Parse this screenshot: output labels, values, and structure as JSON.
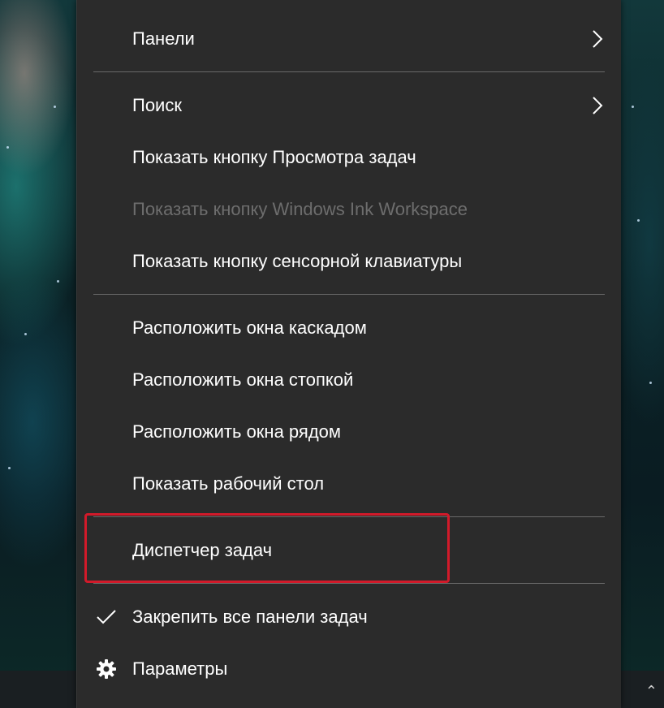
{
  "menu": {
    "items": [
      {
        "label": "Панели",
        "submenu": true,
        "enabled": true
      },
      {
        "label": "Поиск",
        "submenu": true,
        "enabled": true
      },
      {
        "label": "Показать кнопку Просмотра задач",
        "enabled": true
      },
      {
        "label": "Показать кнопку Windows Ink Workspace",
        "enabled": false
      },
      {
        "label": "Показать кнопку сенсорной клавиатуры",
        "enabled": true
      },
      {
        "label": "Расположить окна каскадом",
        "enabled": true
      },
      {
        "label": "Расположить окна стопкой",
        "enabled": true
      },
      {
        "label": "Расположить окна рядом",
        "enabled": true
      },
      {
        "label": "Показать рабочий стол",
        "enabled": true
      },
      {
        "label": "Диспетчер задач",
        "enabled": true,
        "highlighted": true
      },
      {
        "label": "Закрепить все панели задач",
        "checked": true,
        "enabled": true
      },
      {
        "label": "Параметры",
        "icon": "gear-icon",
        "enabled": true
      }
    ]
  },
  "colors": {
    "menu_bg": "#2b2b2b",
    "text": "#ffffff",
    "disabled_text": "#6d6d6d",
    "separator": "#6a6a6a",
    "highlight_border": "#d21a2a"
  }
}
